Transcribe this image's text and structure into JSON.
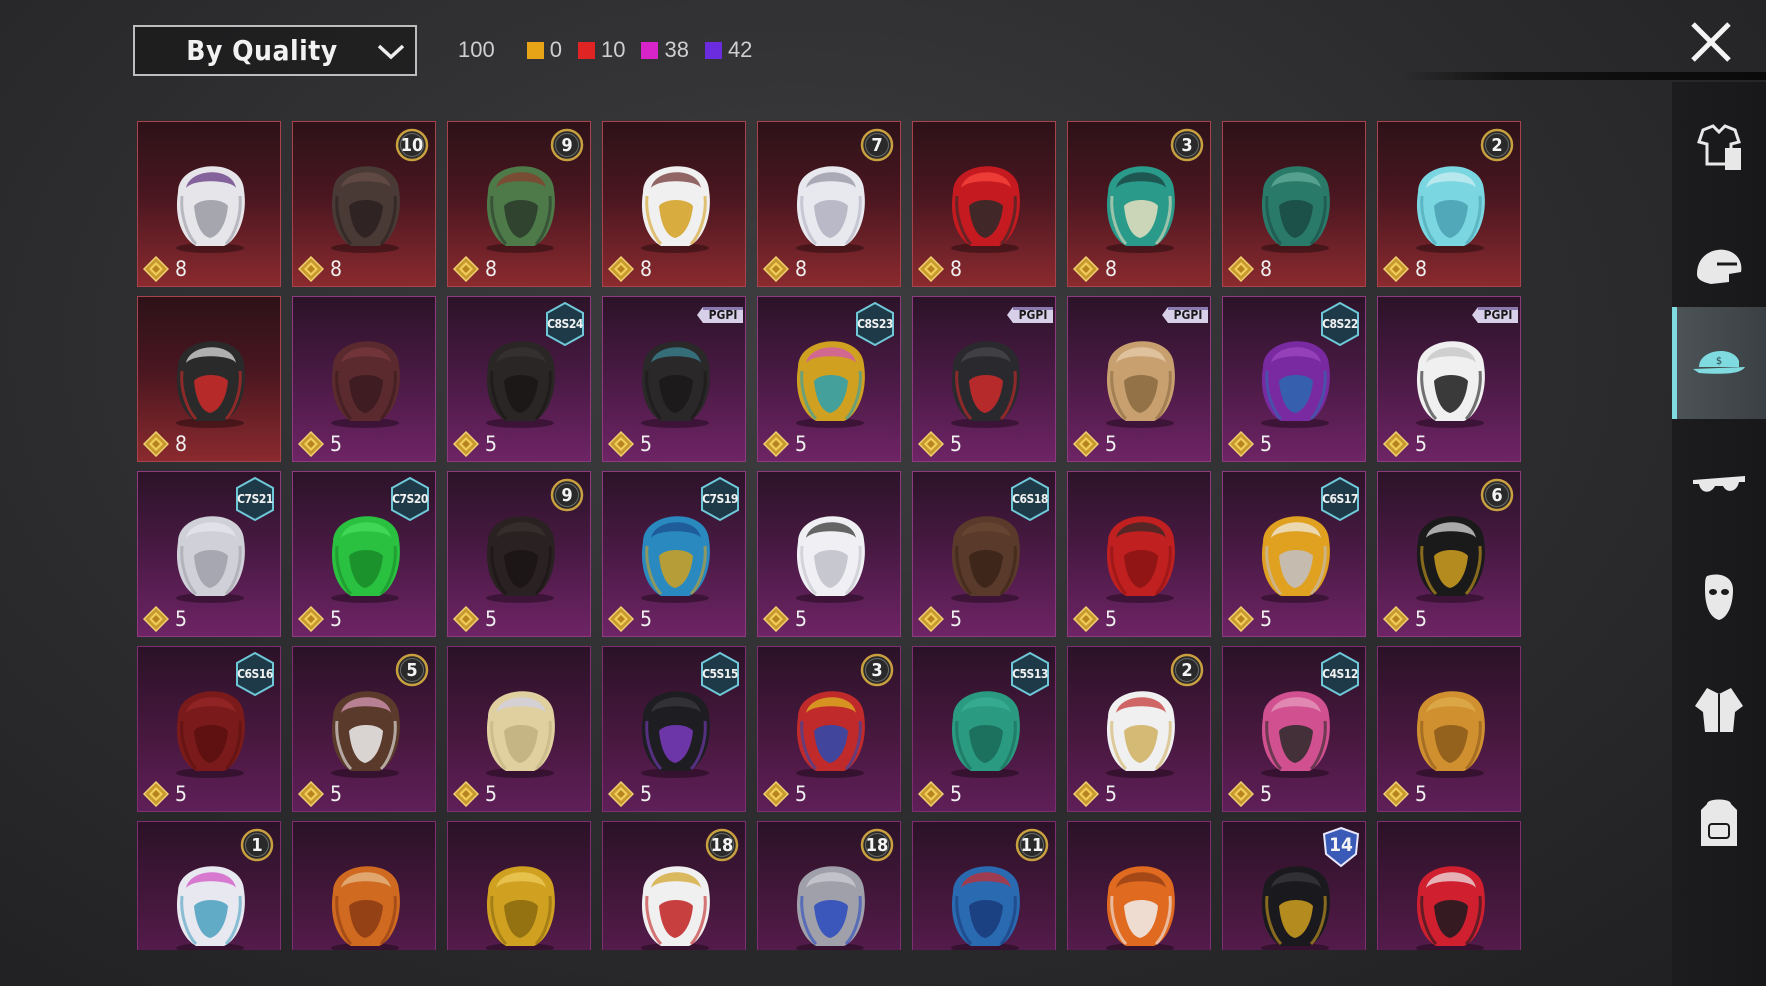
{
  "header": {
    "sort": {
      "label": "By Quality"
    },
    "total_count": "100",
    "quality_counts": [
      {
        "color": "#e6a416",
        "value": "0"
      },
      {
        "color": "#e02424",
        "value": "10"
      },
      {
        "color": "#d624c8",
        "value": "38"
      },
      {
        "color": "#6b2ce0",
        "value": "42"
      }
    ]
  },
  "items": [
    {
      "quality": "red",
      "art": "ghost-white-hair",
      "cost": "8"
    },
    {
      "quality": "red",
      "art": "dark-long-hair",
      "cost": "8",
      "badge": {
        "type": "circle",
        "text": "10"
      }
    },
    {
      "quality": "red",
      "art": "zombie-head",
      "cost": "8",
      "badge": {
        "type": "circle",
        "text": "9"
      }
    },
    {
      "quality": "red",
      "art": "white-cowboy-hat",
      "cost": "8"
    },
    {
      "quality": "red",
      "art": "white-long-hair",
      "cost": "8",
      "badge": {
        "type": "circle",
        "text": "7"
      }
    },
    {
      "quality": "red",
      "art": "red-helmet",
      "cost": "8"
    },
    {
      "quality": "red",
      "art": "joker-mask",
      "cost": "8",
      "badge": {
        "type": "circle",
        "text": "3"
      }
    },
    {
      "quality": "red",
      "art": "green-dragon-helmet",
      "cost": "8"
    },
    {
      "quality": "red",
      "art": "cyan-bucket-hat",
      "cost": "8",
      "badge": {
        "type": "circle",
        "text": "2"
      }
    },
    {
      "quality": "red",
      "art": "demon-mask",
      "cost": "8"
    },
    {
      "quality": "pink",
      "art": "maroon-hair",
      "cost": "5"
    },
    {
      "quality": "pink",
      "art": "black-bob-hair",
      "cost": "5",
      "badge": {
        "type": "hex",
        "text": "C8S24"
      }
    },
    {
      "quality": "pink",
      "art": "black-bun-hair",
      "cost": "5",
      "badge": {
        "type": "ribbon",
        "text": "PGPI"
      }
    },
    {
      "quality": "pink",
      "art": "cat-headphones",
      "cost": "5",
      "badge": {
        "type": "hex",
        "text": "C8S23"
      }
    },
    {
      "quality": "pink",
      "art": "cap-goggles",
      "cost": "5",
      "badge": {
        "type": "ribbon",
        "text": "PGPI"
      }
    },
    {
      "quality": "pink",
      "art": "llama-mask",
      "cost": "5",
      "badge": {
        "type": "ribbon",
        "text": "PGPI"
      }
    },
    {
      "quality": "pink",
      "art": "purple-hair",
      "cost": "5",
      "badge": {
        "type": "hex",
        "text": "C8S22"
      }
    },
    {
      "quality": "pink",
      "art": "panda-mask",
      "cost": "5",
      "badge": {
        "type": "ribbon",
        "text": "PGPI"
      }
    },
    {
      "quality": "pink",
      "art": "silver-hair",
      "cost": "5",
      "badge": {
        "type": "hex",
        "text": "C7S21"
      }
    },
    {
      "quality": "pink",
      "art": "green-pigtails",
      "cost": "5",
      "badge": {
        "type": "hex",
        "text": "C7S20"
      }
    },
    {
      "quality": "pink",
      "art": "dark-straight-hair",
      "cost": "5",
      "badge": {
        "type": "circle",
        "text": "9"
      }
    },
    {
      "quality": "pink",
      "art": "blue-dreadlocks",
      "cost": "5",
      "badge": {
        "type": "hex",
        "text": "C7S19"
      }
    },
    {
      "quality": "pink",
      "art": "white-wild-hair",
      "cost": "5"
    },
    {
      "quality": "pink",
      "art": "brown-short-hair",
      "cost": "5",
      "badge": {
        "type": "hex",
        "text": "C6S18"
      }
    },
    {
      "quality": "pink",
      "art": "red-long-hair",
      "cost": "5"
    },
    {
      "quality": "pink",
      "art": "visor-spiky-hair",
      "cost": "5",
      "badge": {
        "type": "hex",
        "text": "C6S17"
      }
    },
    {
      "quality": "pink",
      "art": "black-gold-helmet",
      "cost": "5",
      "badge": {
        "type": "circle",
        "text": "6"
      }
    },
    {
      "quality": "pink2",
      "art": "red-hood",
      "cost": "5",
      "badge": {
        "type": "hex",
        "text": "C6S16"
      }
    },
    {
      "quality": "pink2",
      "art": "bow-pigtails",
      "cost": "5",
      "badge": {
        "type": "circle",
        "text": "5"
      }
    },
    {
      "quality": "pink2",
      "art": "blonde-curls",
      "cost": "5"
    },
    {
      "quality": "pink2",
      "art": "black-cap",
      "cost": "5",
      "badge": {
        "type": "hex",
        "text": "C5S15"
      }
    },
    {
      "quality": "pink2",
      "art": "jester-hat",
      "cost": "5",
      "badge": {
        "type": "circle",
        "text": "3"
      }
    },
    {
      "quality": "pink2",
      "art": "teal-beanie",
      "cost": "5",
      "badge": {
        "type": "hex",
        "text": "C5S13"
      }
    },
    {
      "quality": "pink2",
      "art": "sailor-hat-blonde",
      "cost": "5",
      "badge": {
        "type": "circle",
        "text": "2"
      }
    },
    {
      "quality": "pink2",
      "art": "pink-visor",
      "cost": "5",
      "badge": {
        "type": "hex",
        "text": "C4S12"
      }
    },
    {
      "quality": "pink2",
      "art": "potato-head",
      "cost": "5"
    },
    {
      "quality": "pink2",
      "art": "white-pink-hair",
      "badge": {
        "type": "circle",
        "text": "1"
      }
    },
    {
      "quality": "pink2",
      "art": "horned-skull"
    },
    {
      "quality": "pink2",
      "art": "gold-spiked-helmet"
    },
    {
      "quality": "pink2",
      "art": "uncle-sam-hat",
      "badge": {
        "type": "circle",
        "text": "18"
      }
    },
    {
      "quality": "pink2",
      "art": "blue-crown-gray-hair",
      "badge": {
        "type": "circle",
        "text": "18"
      }
    },
    {
      "quality": "pink2",
      "art": "blue-beanie",
      "badge": {
        "type": "circle",
        "text": "11"
      }
    },
    {
      "quality": "pink2",
      "art": "orange-robot-helmet"
    },
    {
      "quality": "pink2",
      "art": "officer-cap",
      "badge": {
        "type": "shield",
        "text": "14"
      }
    },
    {
      "quality": "pink2",
      "art": "red-hair-cap"
    }
  ],
  "sidebar": {
    "tabs": [
      {
        "name": "outfit-tab",
        "icon": "outfit-icon"
      },
      {
        "name": "helmet-tab",
        "icon": "helmet-icon"
      },
      {
        "name": "headwear-tab",
        "icon": "cap-icon",
        "active": true
      },
      {
        "name": "eyewear-tab",
        "icon": "glasses-icon"
      },
      {
        "name": "mask-tab",
        "icon": "mask-icon"
      },
      {
        "name": "jacket-tab",
        "icon": "jacket-icon"
      },
      {
        "name": "backpack-tab",
        "icon": "backpack-icon"
      }
    ]
  }
}
